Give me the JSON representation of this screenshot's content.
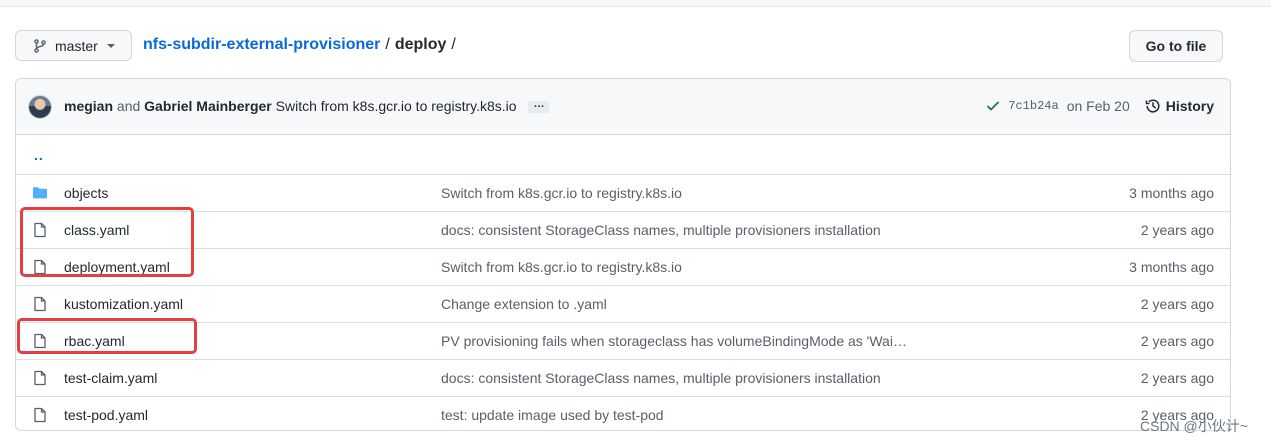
{
  "branch": {
    "label": "master",
    "icon": "git-branch-icon"
  },
  "breadcrumb": {
    "repo": "nfs-subdir-external-provisioner",
    "sep1": "/",
    "dir": "deploy",
    "sep2": "/"
  },
  "goto_file": {
    "label": "Go to file"
  },
  "latest_commit": {
    "author1": "megian",
    "and": "and",
    "author2": "Gabriel Mainberger",
    "message": "Switch from k8s.gcr.io to registry.k8s.io",
    "ellipsis": "…",
    "sha": "7c1b24a",
    "date": "on Feb 20",
    "history_label": "History",
    "status_color": "#1a7f37"
  },
  "parent_dir": {
    "label": ".."
  },
  "files": [
    {
      "type": "folder",
      "name": "objects",
      "message": "Switch from k8s.gcr.io to registry.k8s.io",
      "age": "3 months ago"
    },
    {
      "type": "file",
      "name": "class.yaml",
      "message": "docs: consistent StorageClass names, multiple provisioners installation",
      "age": "2 years ago"
    },
    {
      "type": "file",
      "name": "deployment.yaml",
      "message": "Switch from k8s.gcr.io to registry.k8s.io",
      "age": "3 months ago"
    },
    {
      "type": "file",
      "name": "kustomization.yaml",
      "message": "Change extension to .yaml",
      "age": "2 years ago"
    },
    {
      "type": "file",
      "name": "rbac.yaml",
      "message": "PV provisioning fails when storageclass has volumeBindingMode as 'Wai…",
      "age": "2 years ago"
    },
    {
      "type": "file",
      "name": "test-claim.yaml",
      "message": "docs: consistent StorageClass names, multiple provisioners installation",
      "age": "2 years ago"
    },
    {
      "type": "file",
      "name": "test-pod.yaml",
      "message": "test: update image used by test-pod",
      "age": "2 years ago"
    }
  ],
  "watermark": "CSDN @小伙计~",
  "colors": {
    "link": "#0969da",
    "highlight": "#e0403f",
    "folder": "#54aeff"
  }
}
